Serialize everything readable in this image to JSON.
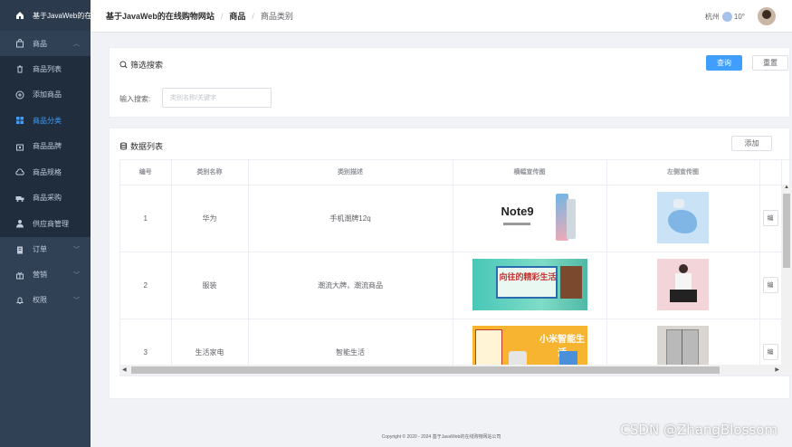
{
  "sidebar": {
    "app_title": "基于JavaWeb的在线购物网站",
    "items": [
      {
        "label": "商品",
        "icon": "bag-icon",
        "type": "parent",
        "arrow": "up"
      },
      {
        "label": "商品列表",
        "icon": "trash-icon",
        "type": "child"
      },
      {
        "label": "添加商品",
        "icon": "plus-circle-icon",
        "type": "child"
      },
      {
        "label": "商品分类",
        "icon": "grid-icon",
        "type": "child",
        "active": true
      },
      {
        "label": "商品品牌",
        "icon": "bag-icon",
        "type": "child"
      },
      {
        "label": "商品规格",
        "icon": "cloud-icon",
        "type": "child"
      },
      {
        "label": "商品采购",
        "icon": "truck-icon",
        "type": "child"
      },
      {
        "label": "供应商管理",
        "icon": "user-icon",
        "type": "child"
      },
      {
        "label": "订单",
        "icon": "clipboard-icon",
        "type": "parent",
        "arrow": "down"
      },
      {
        "label": "营销",
        "icon": "present-icon",
        "type": "parent",
        "arrow": "down"
      },
      {
        "label": "权限",
        "icon": "bell-icon",
        "type": "parent",
        "arrow": "down"
      }
    ]
  },
  "header": {
    "site_name": "基于JavaWeb的在线购物网站",
    "section": "商品",
    "page": "商品类别",
    "city": "杭州",
    "temperature": "10°"
  },
  "filter": {
    "title": "筛选搜索",
    "query_label": "查询",
    "reset_label": "重置",
    "input_label": "输入搜索:",
    "input_placeholder": "类别名称/关键字"
  },
  "list": {
    "title": "数据列表",
    "add_label": "添加",
    "columns": [
      "编号",
      "类别名称",
      "类别描述",
      "横幅宣传图",
      "左侧宣传图"
    ],
    "edit_label": "编",
    "rows": [
      {
        "id": "1",
        "name": "华为",
        "desc": "手机潮牌12q"
      },
      {
        "id": "2",
        "name": "服装",
        "desc": "潮流大牌，潮流商品"
      },
      {
        "id": "3",
        "name": "生活家电",
        "desc": "智能生活"
      }
    ],
    "banner_texts": {
      "row1": "Note9",
      "row2": "向往的精彩生活",
      "row3": "小米智能生活"
    }
  },
  "footer": {
    "text": "Copyright © 2020 - 2024   基于JavaWeb的在线购物网站公司"
  },
  "watermark": "CSDN @ZhangBlossom"
}
